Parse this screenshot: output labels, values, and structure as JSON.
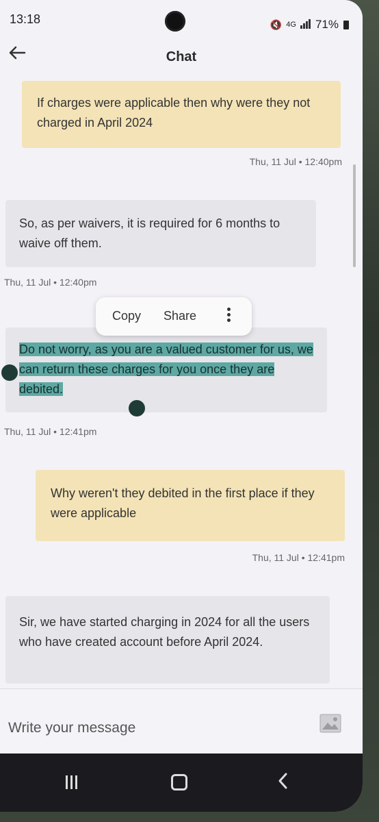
{
  "status_bar": {
    "time": "13:18",
    "network": "4G",
    "battery": "71%"
  },
  "header": {
    "title": "Chat"
  },
  "messages": [
    {
      "type": "sent",
      "text": "If charges were applicable then why were they not charged in April 2024",
      "timestamp": "Thu, 11 Jul • 12:40pm"
    },
    {
      "type": "received",
      "text": "So, as per waivers, it is required for 6 months to waive off them.",
      "timestamp": "Thu, 11 Jul • 12:40pm"
    },
    {
      "type": "received",
      "text": "Do not worry, as you are a valued customer for us, we can return these charges for you once they are debited.",
      "timestamp": "Thu, 11 Jul • 12:41pm",
      "selected": true
    },
    {
      "type": "sent",
      "text": "Why weren't they debited in the first place if they were applicable",
      "timestamp": "Thu, 11 Jul • 12:41pm"
    },
    {
      "type": "received",
      "text": "Sir, we have started charging in 2024 for all the users who have created account before April 2024."
    }
  ],
  "context_menu": {
    "copy_label": "Copy",
    "share_label": "Share",
    "more_icon": "more-vertical-icon"
  },
  "composer": {
    "placeholder": "Write your message",
    "value": "",
    "attach_icon": "image-icon"
  },
  "icons": {
    "back": "back-arrow-icon",
    "recents": "recents-icon",
    "home": "home-icon",
    "nav_back": "nav-back-icon"
  },
  "colors": {
    "sent_bubble": "#f3e3b6",
    "received_bubble": "#e6e5ea",
    "selection": "#5ea8a3"
  }
}
